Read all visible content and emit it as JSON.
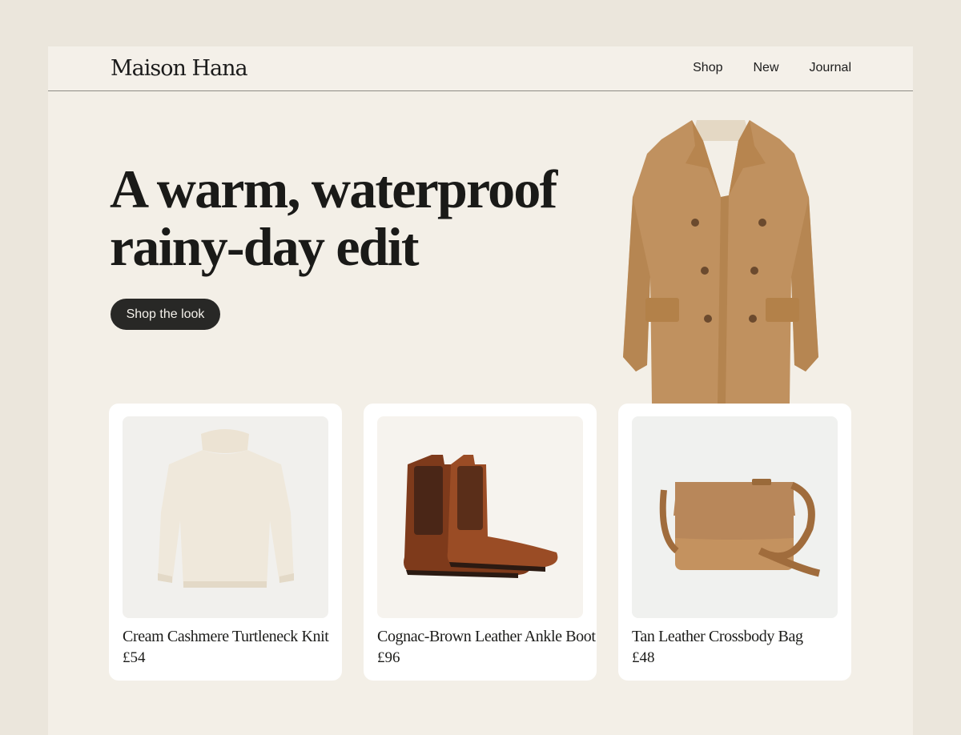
{
  "brand": {
    "name": "Maison Hana"
  },
  "nav": {
    "items": [
      "Shop",
      "New",
      "Journal"
    ]
  },
  "hero": {
    "headline_line1": "A warm, waterproof",
    "headline_line2": "rainy-day edit",
    "cta_label": "Shop the look"
  },
  "products": [
    {
      "name": "Cream Cashmere Turtleneck Knit",
      "price": "£54",
      "icon": "sweater"
    },
    {
      "name": "Cognac-Brown Leather Ankle Boot",
      "price": "£96",
      "icon": "boots"
    },
    {
      "name": "Tan Leather Crossbody Bag",
      "price": "£48",
      "icon": "bag"
    }
  ],
  "colors": {
    "background": "#ebe6dc",
    "page": "#f3efe7",
    "cta": "#282826",
    "camel": "#c0915f",
    "cognac": "#8a3f1c",
    "cream": "#efe8db"
  }
}
